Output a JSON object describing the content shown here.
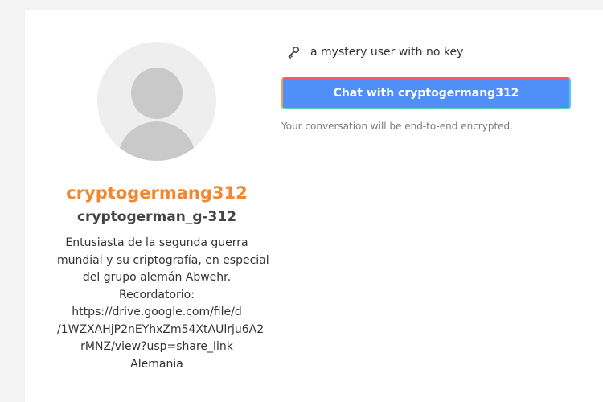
{
  "profile": {
    "display_name": "cryptogermang312",
    "username": "cryptogerman_g-312",
    "bio_lines": [
      "Entusiasta de la segunda guerra",
      "mundial y su criptografía, en especial",
      "del grupo alemán Abwehr.",
      "Recordatorio:",
      "https://drive.google.com/file/d",
      "/1WZXAHjP2nEYhxZm54XtAUlrju6A2",
      "rMNZ/view?usp=share_link",
      "Alemania"
    ],
    "avatar_icon": "default-user-avatar"
  },
  "status": {
    "icon": "key-icon",
    "text": "a mystery user with no key"
  },
  "chat": {
    "button_label": "Chat with cryptogermang312",
    "note": "Your conversation will be end-to-end encrypted."
  },
  "colors": {
    "accent_orange": "#f28732",
    "button_blue": "#4f8ff7",
    "page_bg": "#f3f3f3"
  }
}
